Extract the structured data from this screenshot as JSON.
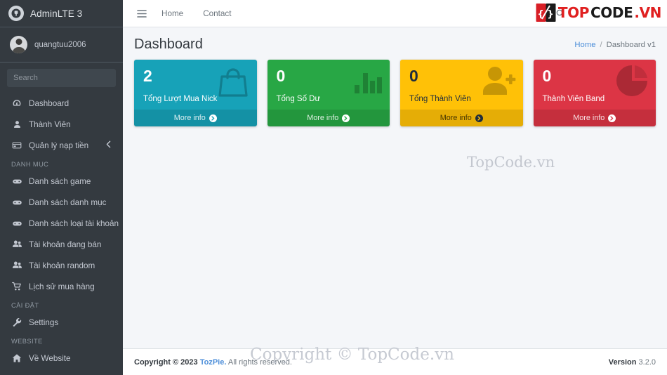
{
  "sidebar": {
    "brand": {
      "title": "AdminLTE 3",
      "logo_icon": "adminlte-circle-logo"
    },
    "user": {
      "name": "quangtuu2006",
      "avatar_icon": "user-avatar-photo"
    },
    "search": {
      "placeholder": "Search",
      "value": "",
      "button_icon": "search-icon"
    },
    "items": [
      {
        "label": "Dashboard",
        "icon": "tachometer-icon",
        "active": false
      },
      {
        "label": "Thành Viên",
        "icon": "user-icon",
        "active": false
      },
      {
        "label": "Quản lý nạp tiền",
        "icon": "credit-card-icon",
        "chevron": "chevron-left-icon",
        "active": false
      }
    ],
    "section_danhmuc": {
      "header": "DANH MỤC",
      "items": [
        {
          "label": "Danh sách game",
          "icon": "gamepad-icon"
        },
        {
          "label": "Danh sách danh mục",
          "icon": "gamepad-icon"
        },
        {
          "label": "Danh sách loại tài khoản",
          "icon": "gamepad-icon"
        },
        {
          "label": "Tài khoản đang bán",
          "icon": "user-friends-icon"
        },
        {
          "label": "Tài khoản random",
          "icon": "user-friends-icon"
        },
        {
          "label": "Lịch sử mua hàng",
          "icon": "shopping-cart-icon"
        }
      ]
    },
    "section_caidat": {
      "header": "CÀI ĐẶT",
      "items": [
        {
          "label": "Settings",
          "icon": "wrench-icon"
        }
      ]
    },
    "section_website": {
      "header": "WEBSITE",
      "items": [
        {
          "label": "Về Website",
          "icon": "home-icon"
        }
      ]
    }
  },
  "navbar": {
    "toggle_icon": "hamburger-icon",
    "links": [
      {
        "label": "Home"
      },
      {
        "label": "Contact"
      }
    ],
    "search_icon": "search-icon"
  },
  "header": {
    "title": "Dashboard",
    "breadcrumb": {
      "home": "Home",
      "separator": "/",
      "current": "Dashboard v1"
    }
  },
  "boxes": [
    {
      "number": "2",
      "label": "Tổng Lượt Mua Nick",
      "more": "More info",
      "icon": "shopping-bag-icon",
      "color": "#17a2b8",
      "theme": "ib-teal"
    },
    {
      "number": "0",
      "label": "Tổng Số Dư",
      "more": "More info",
      "icon": "bar-chart-icon",
      "color": "#28a745",
      "theme": "ib-green"
    },
    {
      "number": "0",
      "label": "Tổng Thành Viên",
      "more": "More info",
      "icon": "user-plus-icon",
      "color": "#ffc107",
      "theme": "ib-yellow"
    },
    {
      "number": "0",
      "label": "Thành Viên Band",
      "more": "More info",
      "icon": "pie-chart-icon",
      "color": "#dc3545",
      "theme": "ib-red"
    }
  ],
  "footer": {
    "copyright_prefix": "Copyright © 2023",
    "brand": "TozPie.",
    "rights": "All rights reserved.",
    "version_label": "Version",
    "version_number": "3.2.0"
  },
  "watermarks": {
    "center": "TopCode.vn",
    "footer": "Copyright © TopCode.vn",
    "logo_top": "TOP",
    "logo_code": "CODE",
    "logo_vn": ".VN",
    "logo_icon": "topcode-braces-logo"
  }
}
